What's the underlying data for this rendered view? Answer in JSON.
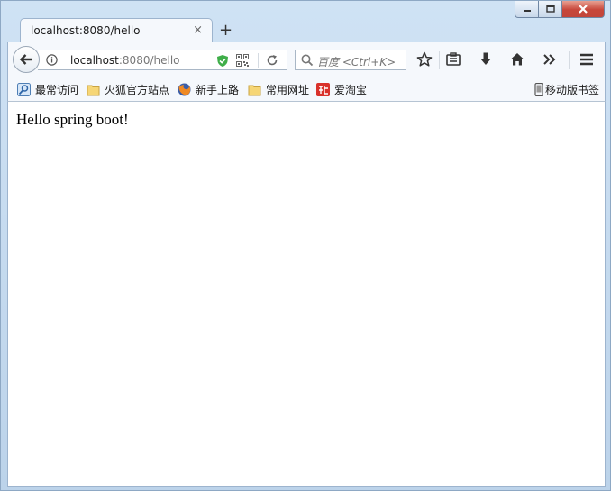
{
  "window": {
    "controls": [
      "minimize",
      "maximize",
      "close"
    ]
  },
  "tab": {
    "title": "localhost:8080/hello",
    "close_glyph": "×",
    "new_tab_glyph": "+"
  },
  "navbar": {
    "url_host": "localhost",
    "url_rest": ":8080/hello",
    "search_placeholder": "百度 <Ctrl+K>",
    "icons": [
      "back-icon",
      "info-icon",
      "shield-icon",
      "qr-code-icon",
      "reload-icon",
      "search-icon",
      "star-icon",
      "reading-list-icon",
      "download-icon",
      "home-icon",
      "overflow-icon",
      "menu-icon"
    ]
  },
  "bookmarks": {
    "items": [
      {
        "label": "最常访问",
        "icon": "most-visited-icon"
      },
      {
        "label": "火狐官方站点",
        "icon": "folder-icon"
      },
      {
        "label": "新手上路",
        "icon": "firefox-icon"
      },
      {
        "label": "常用网址",
        "icon": "folder-icon"
      },
      {
        "label": "爱淘宝",
        "icon": "taobao-icon"
      }
    ],
    "mobile": {
      "label": "移动版书签",
      "icon": "mobile-icon"
    }
  },
  "content": {
    "text": "Hello spring boot!"
  },
  "colors": {
    "shield": "#3fae49",
    "close_button": "#c7463a",
    "taobao": "#d9322b"
  }
}
